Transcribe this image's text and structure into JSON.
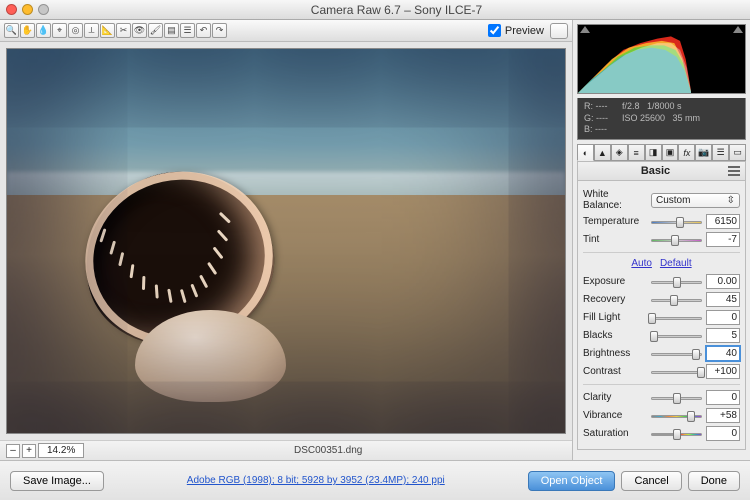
{
  "window": {
    "title": "Camera Raw 6.7  –  Sony ILCE-7"
  },
  "toolbar": {
    "preview_label": "Preview",
    "preview_checked": true
  },
  "preview": {
    "zoom": "14.2%",
    "filename": "DSC00351.dng"
  },
  "readout": {
    "r": "R:   ----",
    "g": "G:   ----",
    "b": "B:   ----",
    "aperture": "f/2.8",
    "shutter": "1/8000 s",
    "iso": "ISO 25600",
    "focal": "35 mm"
  },
  "panel": {
    "title": "Basic",
    "wb_label": "White Balance:",
    "wb_value": "Custom",
    "auto": "Auto",
    "default": "Default",
    "sliders": {
      "temperature": {
        "label": "Temperature",
        "value": "6150",
        "pos": 56
      },
      "tint": {
        "label": "Tint",
        "value": "-7",
        "pos": 47
      },
      "exposure": {
        "label": "Exposure",
        "value": "0.00",
        "pos": 50
      },
      "recovery": {
        "label": "Recovery",
        "value": "45",
        "pos": 45
      },
      "filllight": {
        "label": "Fill Light",
        "value": "0",
        "pos": 1
      },
      "blacks": {
        "label": "Blacks",
        "value": "5",
        "pos": 5
      },
      "brightness": {
        "label": "Brightness",
        "value": "40",
        "pos": 88
      },
      "contrast": {
        "label": "Contrast",
        "value": "+100",
        "pos": 99
      },
      "clarity": {
        "label": "Clarity",
        "value": "0",
        "pos": 50
      },
      "vibrance": {
        "label": "Vibrance",
        "value": "+58",
        "pos": 79
      },
      "saturation": {
        "label": "Saturation",
        "value": "0",
        "pos": 50
      }
    }
  },
  "footer": {
    "save": "Save Image...",
    "meta": "Adobe RGB (1998); 8 bit; 5928 by 3952 (23.4MP); 240 ppi",
    "open": "Open Object",
    "cancel": "Cancel",
    "done": "Done"
  }
}
